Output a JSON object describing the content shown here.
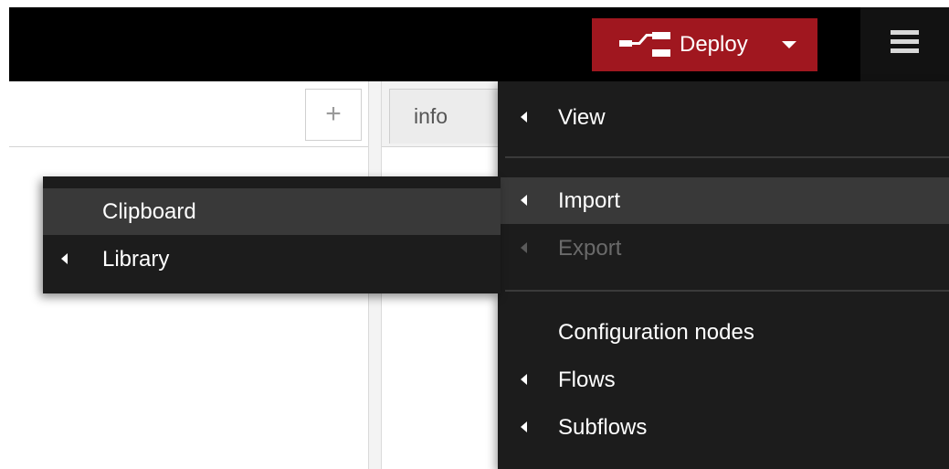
{
  "header": {
    "deploy_label": "Deploy",
    "deploy_icon": "deploy-icon",
    "deploy_caret_icon": "caret-down-icon",
    "menu_icon": "hamburger-icon",
    "colors": {
      "header_bg": "#000000",
      "deploy_bg": "#a0171f"
    }
  },
  "workspace": {
    "add_tab_label": "+"
  },
  "sidebar": {
    "tabs": [
      {
        "label": "info"
      }
    ]
  },
  "main_menu": {
    "items": [
      {
        "label": "View",
        "has_submenu": true
      },
      {
        "label": "Import",
        "has_submenu": true,
        "active": true
      },
      {
        "label": "Export",
        "has_submenu": true,
        "disabled": true
      },
      {
        "label": "Configuration nodes",
        "has_submenu": false
      },
      {
        "label": "Flows",
        "has_submenu": true
      },
      {
        "label": "Subflows",
        "has_submenu": true
      }
    ]
  },
  "import_submenu": {
    "items": [
      {
        "label": "Clipboard",
        "has_submenu": false,
        "active": true
      },
      {
        "label": "Library",
        "has_submenu": true
      }
    ]
  }
}
